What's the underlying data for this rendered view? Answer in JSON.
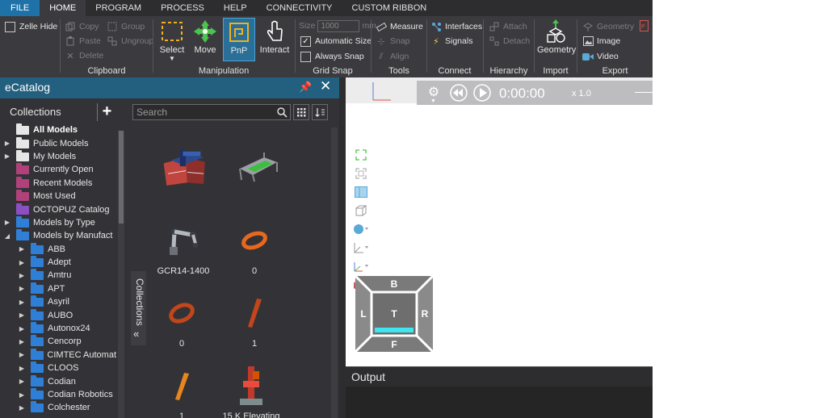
{
  "menu": {
    "tabs": [
      {
        "label": "FILE"
      },
      {
        "label": "HOME"
      },
      {
        "label": "PROGRAM"
      },
      {
        "label": "PROCESS"
      },
      {
        "label": "HELP"
      },
      {
        "label": "CONNECTIVITY"
      },
      {
        "label": "CUSTOM RIBBON"
      }
    ],
    "active": "HOME"
  },
  "ribbon": {
    "zelle_hide": "Zelle Hide",
    "clipboard": {
      "label": "Clipboard",
      "copy": "Copy",
      "paste": "Paste",
      "delete": "Delete",
      "group": "Group",
      "ungroup": "Ungroup"
    },
    "manipulation": {
      "label": "Manipulation",
      "select": "Select",
      "move": "Move",
      "pnp": "PnP",
      "interact": "Interact"
    },
    "grid_snap": {
      "label": "Grid Snap",
      "size_label": "Size",
      "size_value": "1000",
      "size_unit": "mm",
      "automatic_size": "Automatic Size",
      "always_snap": "Always Snap"
    },
    "tools": {
      "label": "Tools",
      "measure": "Measure",
      "snap": "Snap",
      "align": "Align"
    },
    "connect": {
      "label": "Connect",
      "interfaces": "Interfaces",
      "signals": "Signals"
    },
    "hierarchy": {
      "label": "Hierarchy",
      "attach": "Attach",
      "detach": "Detach"
    },
    "import": {
      "label": "Import",
      "geometry": "Geometry"
    },
    "export": {
      "label": "Export",
      "geometry": "Geometry",
      "image": "Image",
      "video": "Video"
    }
  },
  "ecatalog": {
    "title": "eCatalog",
    "collections": {
      "title": "Collections",
      "items": [
        {
          "label": "All Models",
          "bold": true,
          "arrow": "",
          "color": "#e6e6e6",
          "depth": 0
        },
        {
          "label": "Public Models",
          "bold": false,
          "arrow": "▶",
          "color": "#e6e6e6",
          "depth": 0
        },
        {
          "label": "My Models",
          "bold": false,
          "arrow": "▶",
          "color": "#e6e6e6",
          "depth": 0
        },
        {
          "label": "Currently Open",
          "bold": false,
          "arrow": "",
          "color": "#b0417a",
          "depth": 0
        },
        {
          "label": "Recent Models",
          "bold": false,
          "arrow": "",
          "color": "#b0417a",
          "depth": 0
        },
        {
          "label": "Most Used",
          "bold": false,
          "arrow": "",
          "color": "#b0417a",
          "depth": 0
        },
        {
          "label": "OCTOPUZ Catalog",
          "bold": false,
          "arrow": "",
          "color": "#8b4fc1",
          "depth": 0
        },
        {
          "label": "Models by Type",
          "bold": false,
          "arrow": "▶",
          "color": "#2f7fd6",
          "depth": 0
        },
        {
          "label": "Models by Manufact",
          "bold": false,
          "arrow": "◢",
          "color": "#2f7fd6",
          "depth": 0
        },
        {
          "label": "ABB",
          "bold": false,
          "arrow": "▶",
          "color": "#2f7fd6",
          "depth": 1
        },
        {
          "label": "Adept",
          "bold": false,
          "arrow": "▶",
          "color": "#2f7fd6",
          "depth": 1
        },
        {
          "label": "Amtru",
          "bold": false,
          "arrow": "▶",
          "color": "#2f7fd6",
          "depth": 1
        },
        {
          "label": "APT",
          "bold": false,
          "arrow": "▶",
          "color": "#2f7fd6",
          "depth": 1
        },
        {
          "label": "Asyril",
          "bold": false,
          "arrow": "▶",
          "color": "#2f7fd6",
          "depth": 1
        },
        {
          "label": "AUBO",
          "bold": false,
          "arrow": "▶",
          "color": "#2f7fd6",
          "depth": 1
        },
        {
          "label": "Autonox24",
          "bold": false,
          "arrow": "▶",
          "color": "#2f7fd6",
          "depth": 1
        },
        {
          "label": "Cencorp",
          "bold": false,
          "arrow": "▶",
          "color": "#2f7fd6",
          "depth": 1
        },
        {
          "label": "CIMTEC Automat",
          "bold": false,
          "arrow": "▶",
          "color": "#2f7fd6",
          "depth": 1
        },
        {
          "label": "CLOOS",
          "bold": false,
          "arrow": "▶",
          "color": "#2f7fd6",
          "depth": 1
        },
        {
          "label": "Codian",
          "bold": false,
          "arrow": "▶",
          "color": "#2f7fd6",
          "depth": 1
        },
        {
          "label": "Codian Robotics",
          "bold": false,
          "arrow": "▶",
          "color": "#2f7fd6",
          "depth": 1
        },
        {
          "label": "Colchester",
          "bold": false,
          "arrow": "▶",
          "color": "#2f7fd6",
          "depth": 1
        }
      ]
    },
    "search": {
      "placeholder": "Search",
      "value": ""
    },
    "side_tab": "Collections",
    "models": [
      {
        "label": "",
        "thumb": "robot-cell-thumbnail"
      },
      {
        "label": "",
        "thumb": "conveyor-fixture-thumbnail"
      },
      {
        "label": "GCR14-1400",
        "thumb": "robot-arm-thumbnail"
      },
      {
        "label": "0",
        "thumb": "digit-zero-thumbnail"
      },
      {
        "label": "0",
        "thumb": "digit-zero-thumbnail"
      },
      {
        "label": "1",
        "thumb": "digit-one-thumbnail"
      },
      {
        "label": "1",
        "thumb": "digit-one-thumbnail"
      },
      {
        "label": "15 K Elevating",
        "thumb": "elevating-positioner-thumbnail"
      }
    ]
  },
  "viewport": {
    "time": "0:00:00",
    "speed": "x  1.0",
    "cube": {
      "top": "B",
      "left": "L",
      "center": "T",
      "right": "R",
      "bottom": "F"
    }
  },
  "output": {
    "title": "Output"
  }
}
